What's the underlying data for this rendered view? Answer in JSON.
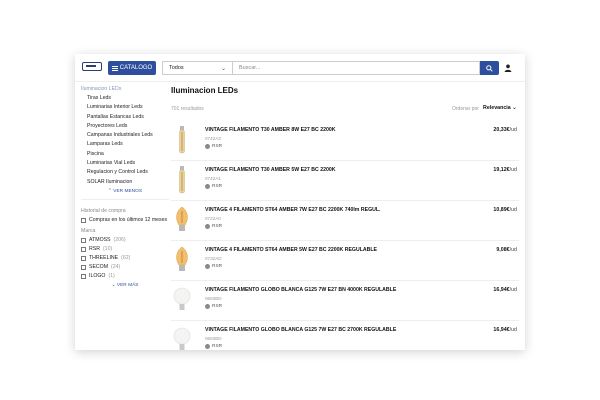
{
  "header": {
    "catalog_label": "CATALOGO",
    "search_scope": "Todos",
    "search_placeholder": "Buscar..."
  },
  "sidebar": {
    "category_head": "Iluminacion LEDs",
    "categories": [
      "Tiras Leds",
      "Luminarias Interior Leds",
      "Pantallas Estancas Leds",
      "Proyectores Leds",
      "Campanas Industriales Leds",
      "Lamparas Leds",
      "Piscina",
      "Luminarias Vial Leds",
      "Regulacion y Control Leds",
      "SOLAR Iluminacion"
    ],
    "show_less": "VER MENOS",
    "history_head": "Historial de compra",
    "history_option": "Compras en los últimos 12 meses",
    "brand_head": "Marca",
    "brands": [
      {
        "name": "ATMOSS",
        "count": "(206)"
      },
      {
        "name": "RSR",
        "count": "(10)"
      },
      {
        "name": "THREELINE",
        "count": "(62)"
      },
      {
        "name": "SECOM",
        "count": "(24)"
      },
      {
        "name": "ILOGO",
        "count": "(1)"
      }
    ],
    "show_more": "VER MÁS"
  },
  "main": {
    "title": "Iluminacion LEDs",
    "results": "701 resultados",
    "sort_label": "Ordenar por",
    "sort_value": "Relevancia"
  },
  "products": [
    {
      "name": "VINTAGE FILAMENTO T30 AMBER 8W E27 BC 2200K",
      "ref": "0742A3",
      "brand": "RSR",
      "price": "20,33€",
      "unit": "/ud",
      "thumb": "tube"
    },
    {
      "name": "VINTAGE FILAMENTO T30 AMBER 5W E27 BC 2200K",
      "ref": "0742A1",
      "brand": "RSR",
      "price": "19,12€",
      "unit": "/ud",
      "thumb": "tube"
    },
    {
      "name": "VINTAGE 4 FILAMENTO ST64 AMBER 7W E27 BC 2200K 740lm REGUL.",
      "ref": "0722A0",
      "brand": "RSR",
      "price": "10,89€",
      "unit": "/ud",
      "thumb": "edison"
    },
    {
      "name": "VINTAGE 4 FILAMENTO ST64 AMBER 5W E27 BC 2200K REGULABLE",
      "ref": "0732AD",
      "brand": "RSR",
      "price": "9,08€",
      "unit": "/ud",
      "thumb": "edison"
    },
    {
      "name": "VINTAGE FILAMENTO GLOBO BLANCA G125 7W E27 BN 4000K REGULABLE",
      "ref": "0683BD",
      "brand": "RSR",
      "price": "16,94€",
      "unit": "/ud",
      "thumb": "globe"
    },
    {
      "name": "VINTAGE FILAMENTO GLOBO BLANCA G125 7W E27 BC 2700K REGULABLE",
      "ref": "0683BD",
      "brand": "RSR",
      "price": "16,94€",
      "unit": "/ud",
      "thumb": "globe"
    }
  ],
  "colors": {
    "accent": "#2d4f9e",
    "category_head": "#8a97b5"
  }
}
